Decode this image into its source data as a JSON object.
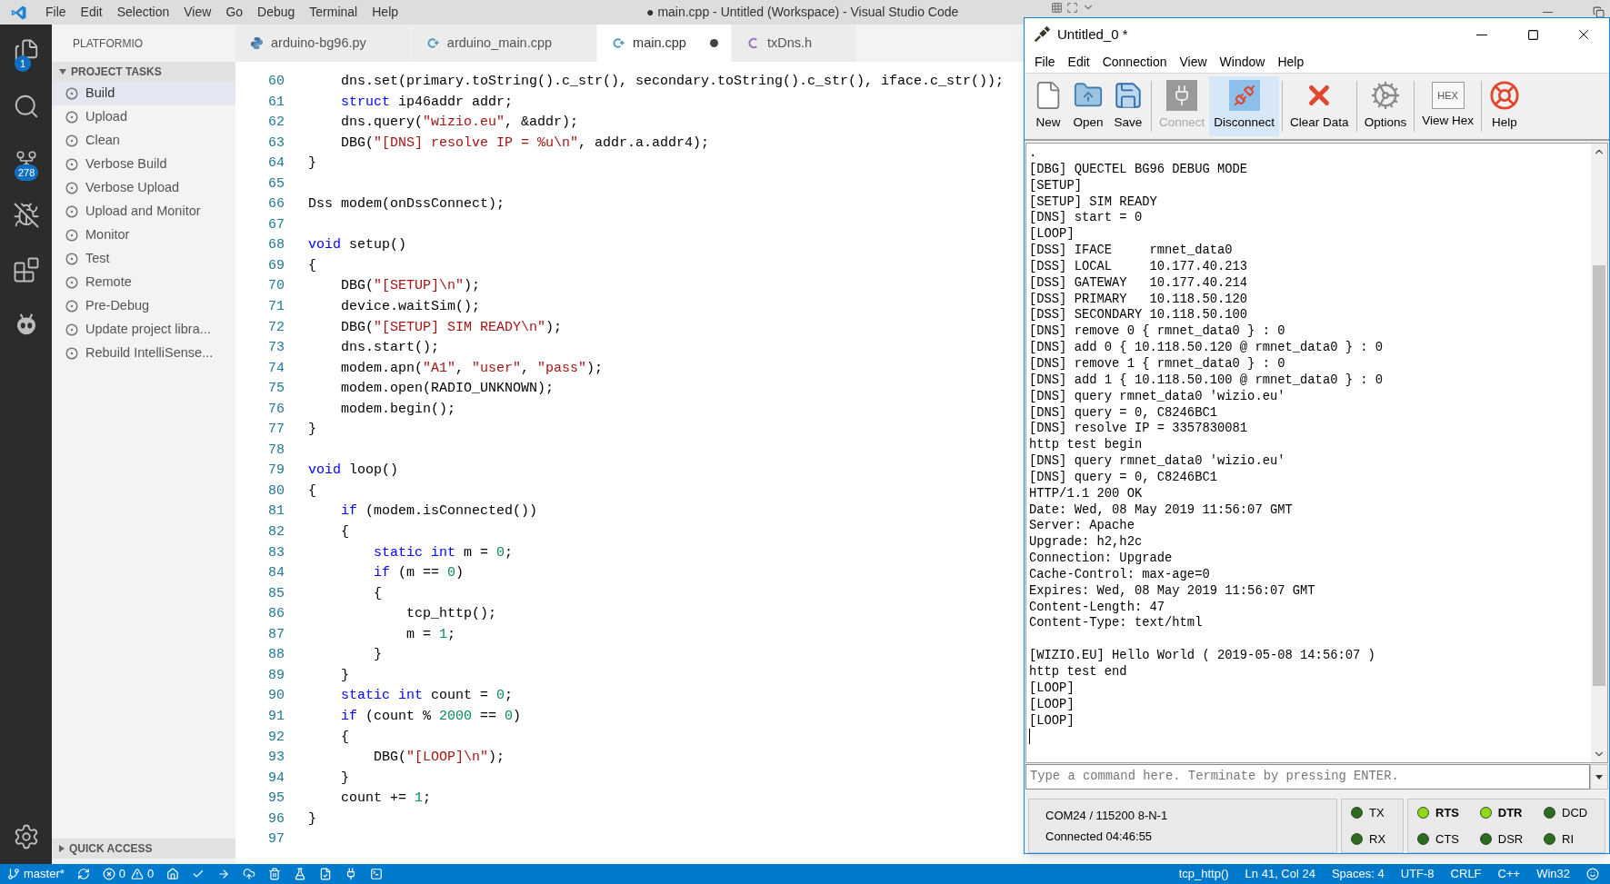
{
  "titlebar": {
    "menu": [
      "File",
      "Edit",
      "Selection",
      "View",
      "Go",
      "Debug",
      "Terminal",
      "Help"
    ],
    "title": "● main.cpp - Untitled (Workspace) - Visual Studio Code"
  },
  "activity_bar": {
    "top": [
      {
        "kind": "files",
        "badge": "1"
      },
      {
        "kind": "search"
      },
      {
        "kind": "source-control",
        "badge": "278"
      },
      {
        "kind": "debug"
      },
      {
        "kind": "extensions"
      },
      {
        "kind": "platformio"
      }
    ],
    "bottom": [
      {
        "kind": "settings"
      }
    ]
  },
  "sidebar": {
    "title": "PLATFORMIO",
    "sections": [
      {
        "title": "PROJECT TASKS",
        "expanded": true,
        "items": [
          {
            "label": "Build",
            "selected": true
          },
          {
            "label": "Upload",
            "selected": false
          },
          {
            "label": "Clean",
            "selected": false
          },
          {
            "label": "Verbose Build",
            "selected": false
          },
          {
            "label": "Verbose Upload",
            "selected": false
          },
          {
            "label": "Upload and Monitor",
            "selected": false
          },
          {
            "label": "Monitor",
            "selected": false
          },
          {
            "label": "Test",
            "selected": false
          },
          {
            "label": "Remote",
            "selected": false
          },
          {
            "label": "Pre-Debug",
            "selected": false
          },
          {
            "label": "Update project libra...",
            "selected": false
          },
          {
            "label": "Rebuild IntelliSense...",
            "selected": false
          }
        ]
      },
      {
        "title": "QUICK ACCESS",
        "expanded": false
      }
    ]
  },
  "tabs": [
    {
      "label": "arduino-bg96.py",
      "kind": "python",
      "selected": false,
      "modified": false
    },
    {
      "label": "arduino_main.cpp",
      "kind": "cpp",
      "selected": false,
      "modified": false
    },
    {
      "label": "main.cpp",
      "kind": "cpp",
      "selected": true,
      "modified": true
    },
    {
      "label": "txDns.h",
      "kind": "c",
      "selected": false,
      "modified": false
    }
  ],
  "editor": {
    "lines": [
      {
        "number": "60",
        "tokens": [
          {
            "text": "    dns.set(primary.toString().c_str(), secondary.toString().c_str(), iface.c_str());",
            "kind": "plain"
          }
        ]
      },
      {
        "number": "61",
        "tokens": [
          {
            "text": "    struct",
            "kind": "keyword"
          },
          {
            "text": " ip46addr addr;",
            "kind": "plain"
          }
        ]
      },
      {
        "number": "62",
        "tokens": [
          {
            "text": "    dns.query(",
            "kind": "plain"
          },
          {
            "text": "\"wizio.eu\"",
            "kind": "string"
          },
          {
            "text": ", &addr);",
            "kind": "plain"
          }
        ]
      },
      {
        "number": "63",
        "tokens": [
          {
            "text": "    DBG(",
            "kind": "plain"
          },
          {
            "text": "\"[DNS] resolve IP = %u\\n\"",
            "kind": "string"
          },
          {
            "text": ", addr.a.addr4);",
            "kind": "plain"
          }
        ]
      },
      {
        "number": "64",
        "tokens": [
          {
            "text": "}",
            "kind": "plain"
          }
        ]
      },
      {
        "number": "65"
      },
      {
        "number": "66",
        "tokens": [
          {
            "text": "Dss modem(onDssConnect);",
            "kind": "plain"
          }
        ]
      },
      {
        "number": "67"
      },
      {
        "number": "68",
        "tokens": [
          {
            "text": "void",
            "kind": "keyword"
          },
          {
            "text": " setup()",
            "kind": "plain"
          }
        ]
      },
      {
        "number": "69",
        "tokens": [
          {
            "text": "{",
            "kind": "plain"
          }
        ]
      },
      {
        "number": "70",
        "tokens": [
          {
            "text": "    DBG(",
            "kind": "plain"
          },
          {
            "text": "\"[SETUP]\\n\"",
            "kind": "string"
          },
          {
            "text": ");",
            "kind": "plain"
          }
        ]
      },
      {
        "number": "71",
        "tokens": [
          {
            "text": "    device.waitSim();",
            "kind": "plain"
          }
        ]
      },
      {
        "number": "72",
        "tokens": [
          {
            "text": "    DBG(",
            "kind": "plain"
          },
          {
            "text": "\"[SETUP] SIM READY\\n\"",
            "kind": "string"
          },
          {
            "text": ");",
            "kind": "plain"
          }
        ]
      },
      {
        "number": "73",
        "tokens": [
          {
            "text": "    dns.start();",
            "kind": "plain"
          }
        ]
      },
      {
        "number": "74",
        "tokens": [
          {
            "text": "    modem.apn(",
            "kind": "plain"
          },
          {
            "text": "\"A1\"",
            "kind": "string"
          },
          {
            "text": ", ",
            "kind": "plain"
          },
          {
            "text": "\"user\"",
            "kind": "string"
          },
          {
            "text": ", ",
            "kind": "plain"
          },
          {
            "text": "\"pass\"",
            "kind": "string"
          },
          {
            "text": ");",
            "kind": "plain"
          }
        ]
      },
      {
        "number": "75",
        "tokens": [
          {
            "text": "    modem.open(RADIO_UNKNOWN);",
            "kind": "plain"
          }
        ]
      },
      {
        "number": "76",
        "tokens": [
          {
            "text": "    modem.begin();",
            "kind": "plain"
          }
        ]
      },
      {
        "number": "77",
        "tokens": [
          {
            "text": "}",
            "kind": "plain"
          }
        ]
      },
      {
        "number": "78"
      },
      {
        "number": "79",
        "tokens": [
          {
            "text": "void",
            "kind": "keyword"
          },
          {
            "text": " loop()",
            "kind": "plain"
          }
        ]
      },
      {
        "number": "80",
        "tokens": [
          {
            "text": "{",
            "kind": "plain"
          }
        ]
      },
      {
        "number": "81",
        "tokens": [
          {
            "text": "    if",
            "kind": "keyword"
          },
          {
            "text": " (modem.isConnected())",
            "kind": "plain"
          }
        ]
      },
      {
        "number": "82",
        "tokens": [
          {
            "text": "    {",
            "kind": "plain"
          }
        ]
      },
      {
        "number": "83",
        "tokens": [
          {
            "text": "        static int",
            "kind": "keyword"
          },
          {
            "text": " m = ",
            "kind": "plain"
          },
          {
            "text": "0",
            "kind": "number"
          },
          {
            "text": ";",
            "kind": "plain"
          }
        ]
      },
      {
        "number": "84",
        "tokens": [
          {
            "text": "        if",
            "kind": "keyword"
          },
          {
            "text": " (m == ",
            "kind": "plain"
          },
          {
            "text": "0",
            "kind": "number"
          },
          {
            "text": ")",
            "kind": "plain"
          }
        ]
      },
      {
        "number": "85",
        "tokens": [
          {
            "text": "        {",
            "kind": "plain"
          }
        ]
      },
      {
        "number": "86",
        "tokens": [
          {
            "text": "            tcp_http();",
            "kind": "plain"
          }
        ]
      },
      {
        "number": "87",
        "tokens": [
          {
            "text": "            m = ",
            "kind": "plain"
          },
          {
            "text": "1",
            "kind": "number"
          },
          {
            "text": ";",
            "kind": "plain"
          }
        ]
      },
      {
        "number": "88",
        "tokens": [
          {
            "text": "        }",
            "kind": "plain"
          }
        ]
      },
      {
        "number": "89",
        "tokens": [
          {
            "text": "    }",
            "kind": "plain"
          }
        ]
      },
      {
        "number": "90",
        "tokens": [
          {
            "text": "    static int",
            "kind": "keyword"
          },
          {
            "text": " count = ",
            "kind": "plain"
          },
          {
            "text": "0",
            "kind": "number"
          },
          {
            "text": ";",
            "kind": "plain"
          }
        ]
      },
      {
        "number": "91",
        "tokens": [
          {
            "text": "    if",
            "kind": "keyword"
          },
          {
            "text": " (count % ",
            "kind": "plain"
          },
          {
            "text": "2000",
            "kind": "number"
          },
          {
            "text": " == ",
            "kind": "plain"
          },
          {
            "text": "0",
            "kind": "number"
          },
          {
            "text": ")",
            "kind": "plain"
          }
        ]
      },
      {
        "number": "92",
        "tokens": [
          {
            "text": "    {",
            "kind": "plain"
          }
        ]
      },
      {
        "number": "93",
        "tokens": [
          {
            "text": "        DBG(",
            "kind": "plain"
          },
          {
            "text": "\"[LOOP]\\n\"",
            "kind": "string"
          },
          {
            "text": ");",
            "kind": "plain"
          }
        ]
      },
      {
        "number": "94",
        "tokens": [
          {
            "text": "    }",
            "kind": "plain"
          }
        ]
      },
      {
        "number": "95",
        "tokens": [
          {
            "text": "    count += ",
            "kind": "plain"
          },
          {
            "text": "1",
            "kind": "number"
          },
          {
            "text": ";",
            "kind": "plain"
          }
        ]
      },
      {
        "number": "96",
        "tokens": [
          {
            "text": "}",
            "kind": "plain"
          }
        ]
      },
      {
        "number": "97"
      }
    ]
  },
  "status_bar": {
    "left": [
      {
        "kind": "branch",
        "text": "master*"
      },
      {
        "kind": "sync"
      },
      {
        "kind": "errors",
        "text": "0"
      },
      {
        "kind": "warnings",
        "text": "0"
      },
      {
        "kind": "home"
      },
      {
        "kind": "check"
      },
      {
        "kind": "arrow"
      },
      {
        "kind": "upload"
      },
      {
        "kind": "trash"
      },
      {
        "kind": "flask"
      },
      {
        "kind": "file"
      },
      {
        "kind": "plug"
      },
      {
        "kind": "terminal"
      }
    ],
    "right": [
      {
        "kind": "text",
        "text": "tcp_http()"
      },
      {
        "kind": "text",
        "text": "Ln 41, Col 24"
      },
      {
        "kind": "text",
        "text": "Spaces: 4"
      },
      {
        "kind": "text",
        "text": "UTF-8"
      },
      {
        "kind": "text",
        "text": "CRLF"
      },
      {
        "kind": "text",
        "text": "C++"
      },
      {
        "kind": "text",
        "text": "Win32"
      },
      {
        "kind": "smiley"
      }
    ]
  },
  "serial_window": {
    "title": "Untitled_0 *",
    "menu": [
      "File",
      "Edit",
      "Connection",
      "View",
      "Window",
      "Help"
    ],
    "toolbar": [
      {
        "buttons": [
          {
            "label": "New",
            "kind": "new",
            "disabled": false,
            "selected": false
          },
          {
            "label": "Open",
            "kind": "open",
            "disabled": false,
            "selected": false
          },
          {
            "label": "Save",
            "kind": "save",
            "disabled": false,
            "selected": false
          }
        ]
      },
      {
        "buttons": [
          {
            "label": "Connect",
            "kind": "connect",
            "disabled": true,
            "selected": false
          },
          {
            "label": "Disconnect",
            "kind": "disconnect",
            "disabled": false,
            "selected": true
          }
        ]
      },
      {
        "buttons": [
          {
            "label": "Clear Data",
            "kind": "clear",
            "disabled": false,
            "selected": false
          }
        ]
      },
      {
        "buttons": [
          {
            "label": "Options",
            "kind": "options",
            "disabled": false,
            "selected": false
          }
        ]
      },
      {
        "buttons": [
          {
            "label": "View Hex",
            "kind": "hex",
            "icon_text": "HEX",
            "disabled": false,
            "selected": false
          }
        ]
      },
      {
        "buttons": [
          {
            "label": "Help",
            "kind": "help",
            "disabled": false,
            "selected": false
          }
        ]
      }
    ],
    "output_blocks": [
      [
        ".",
        "[DBG] QUECTEL BG96 DEBUG MODE",
        "[SETUP]",
        "[SETUP] SIM READY",
        "[DNS] start = 0",
        "[LOOP]",
        "[DSS] IFACE     rmnet_data0",
        "[DSS] LOCAL     10.177.40.213",
        "[DSS] GATEWAY   10.177.40.214",
        "[DSS] PRIMARY   10.118.50.120",
        "[DSS] SECONDARY 10.118.50.100",
        "[DNS] remove 0 { rmnet_data0 } : 0",
        "[DNS] add 0 { 10.118.50.120 @ rmnet_data0 } : 0",
        "[DNS] remove 1 { rmnet_data0 } : 0",
        "[DNS] add 1 { 10.118.50.100 @ rmnet_data0 } : 0",
        "[DNS] query rmnet_data0 'wizio.eu'",
        "[DNS] query = 0, C8246BC1",
        "[DNS] resolve IP = 3357830081",
        "http test begin",
        "[DNS] query rmnet_data0 'wizio.eu'",
        "[DNS] query = 0, C8246BC1",
        "HTTP/1.1 200 OK",
        "Date: Wed, 08 May 2019 11:56:07 GMT",
        "Server: Apache",
        "Upgrade: h2,h2c",
        "Connection: Upgrade",
        "Cache-Control: max-age=0",
        "Expires: Wed, 08 May 2019 11:56:07 GMT",
        "Content-Length: 47",
        "Content-Type: text/html"
      ],
      [
        "[WIZIO.EU] Hello World ( 2019-05-08 14:56:07 )",
        "http test end",
        "[LOOP]",
        "[LOOP]",
        "[LOOP]"
      ]
    ],
    "input": {
      "placeholder": "Type a command here. Terminate by pressing ENTER."
    },
    "status": {
      "port": "COM24 / 115200 8-N-1",
      "connection": "Connected 04:46:55"
    },
    "signal_groups": [
      [
        {
          "label": "TX",
          "on": false
        },
        {
          "label": "RX",
          "on": false
        }
      ],
      [
        {
          "label": "RTS",
          "on": true
        },
        {
          "label": "CTS",
          "on": false
        },
        {
          "label": "DTR",
          "on": true
        },
        {
          "label": "DSR",
          "on": false
        },
        {
          "label": "DCD",
          "on": false
        },
        {
          "label": "RI",
          "on": false
        }
      ]
    ]
  }
}
